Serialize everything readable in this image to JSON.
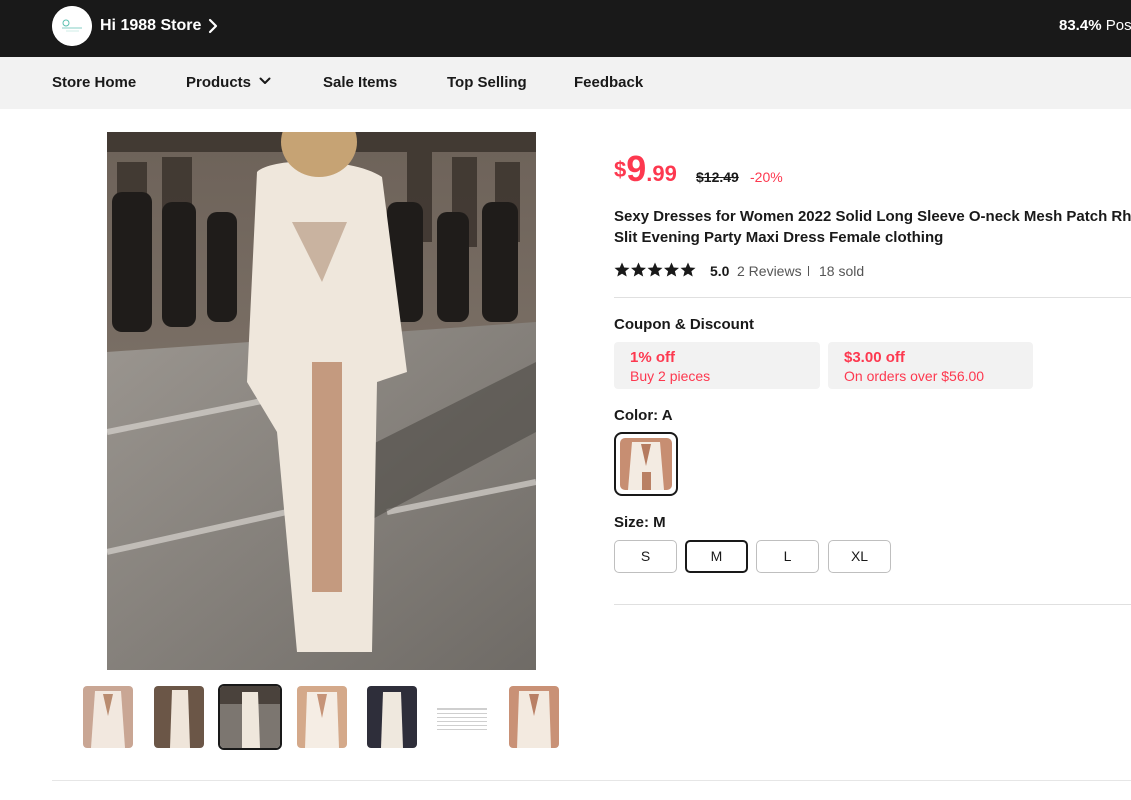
{
  "store": {
    "name": "Hi 1988 Store",
    "positive_rate": "83.4%",
    "positive_label": "Pos"
  },
  "nav": {
    "items": [
      "Store Home",
      "Products",
      "Sale Items",
      "Top Selling",
      "Feedback"
    ]
  },
  "product": {
    "price_currency": "$",
    "price_int": "9",
    "price_dec": ".99",
    "original_price": "$12.49",
    "discount": "-20%",
    "title_line1": "Sexy Dresses for Women 2022 Solid Long Sleeve O-neck Mesh Patch Rh",
    "title_line2": "Slit Evening Party Maxi Dress Female clothing",
    "rating": 5.0,
    "rating_text": "5.0",
    "reviews": "2 Reviews",
    "sold": "18 sold"
  },
  "coupons": {
    "label": "Coupon & Discount",
    "items": [
      {
        "main": "1% off",
        "sub": "Buy 2 pieces"
      },
      {
        "main": "$3.00 off",
        "sub": "On orders over $56.00"
      }
    ]
  },
  "color": {
    "label": "Color: A"
  },
  "size": {
    "label": "Size: M",
    "options": [
      "S",
      "M",
      "L",
      "XL"
    ],
    "selected": "M"
  },
  "gallery": {
    "selected_index": 2,
    "thumb_count": 7
  },
  "icons": {
    "chevron": "chevron-right-icon",
    "dropdown": "chevron-down-icon",
    "star": "star-icon"
  },
  "colors": {
    "accent": "#fd384f",
    "dark": "#191919"
  }
}
